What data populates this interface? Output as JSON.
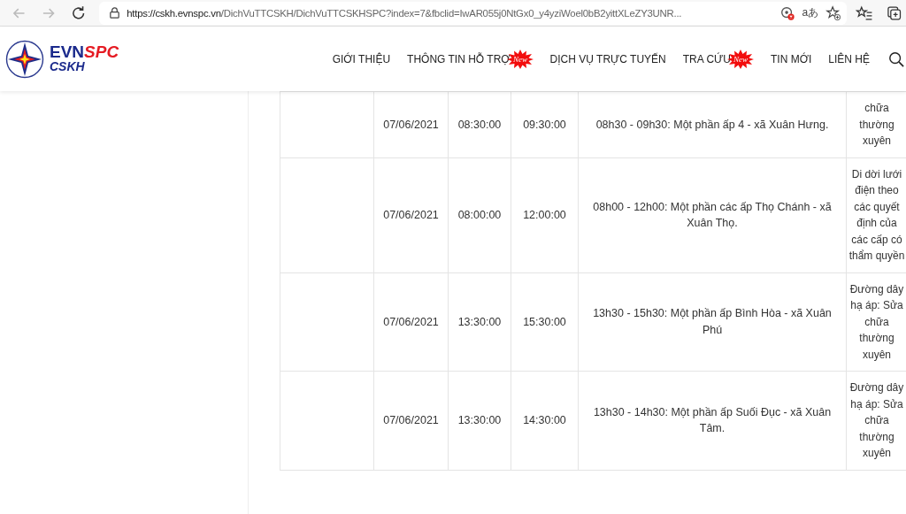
{
  "browser": {
    "address": {
      "host": "https://cskh.evnspc.vn",
      "path": "/DichVuTTCSKH/DichVuTTCSKHSPC?index=7&fbclid=IwAR055j0NtGx0_y4yziWoel0bB2yittXLeZY3UNR..."
    },
    "translate": "aあ"
  },
  "logo": {
    "main": "EVN",
    "accent": "SPC",
    "sub": "CSKH"
  },
  "nav": [
    {
      "label": "GIỚI THIỆU"
    },
    {
      "label": "THÔNG TIN HỖ TRỢ",
      "badge": "New"
    },
    {
      "label": "DỊCH VỤ TRỰC TUYẾN"
    },
    {
      "label": "TRA CỨU",
      "badge": "New"
    },
    {
      "label": "TIN MỚI"
    },
    {
      "label": "LIÊN HỆ"
    }
  ],
  "rows": [
    {
      "date": "07/06/2021",
      "start": "08:30:00",
      "end": "09:30:00",
      "area": "08h30 - 09h30: Một phần ấp 4 - xã Xuân Hưng.",
      "reason": "chữa thường xuyên"
    },
    {
      "date": "07/06/2021",
      "start": "08:00:00",
      "end": "12:00:00",
      "area": "08h00 - 12h00: Một phần các ấp Thọ Chánh - xã Xuân Thọ.",
      "reason": "Di dời lưới điện theo các quyết định của các cấp có thẩm quyền"
    },
    {
      "date": "07/06/2021",
      "start": "13:30:00",
      "end": "15:30:00",
      "area": "13h30 - 15h30: Một phần ấp Bình Hòa - xã Xuân Phú",
      "reason": "Đường dây hạ áp: Sửa chữa thường xuyên"
    },
    {
      "date": "07/06/2021",
      "start": "13:30:00",
      "end": "14:30:00",
      "area": "13h30 - 14h30: Một phần ấp Suối Đục - xã Xuân Tâm.",
      "reason": "Đường dây hạ áp: Sửa chữa thường xuyên"
    }
  ]
}
